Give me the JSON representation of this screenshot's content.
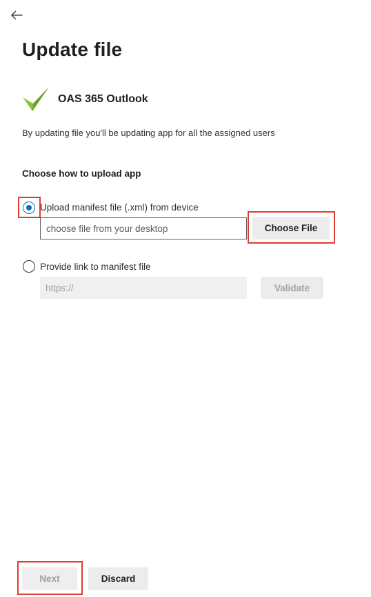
{
  "header": {
    "back_icon": "arrow-left-icon",
    "title": "Update file"
  },
  "app": {
    "logo_icon": "green-checkmark-logo-icon",
    "name": "OAS 365 Outlook"
  },
  "description": "By updating file you'll be updating app for all the assigned users",
  "upload": {
    "section_title": "Choose how to upload app",
    "options": [
      {
        "label": "Upload manifest file (.xml) from device",
        "selected": true
      },
      {
        "label": "Provide link to manifest file",
        "selected": false
      }
    ],
    "file_placeholder": "choose file from your desktop",
    "choose_file_label": "Choose File",
    "link_placeholder": "https://",
    "validate_label": "Validate"
  },
  "footer": {
    "next_label": "Next",
    "discard_label": "Discard"
  },
  "colors": {
    "accent": "#0f6cbd",
    "highlight": "#e03c31",
    "logo_green": "#8cc63f"
  }
}
